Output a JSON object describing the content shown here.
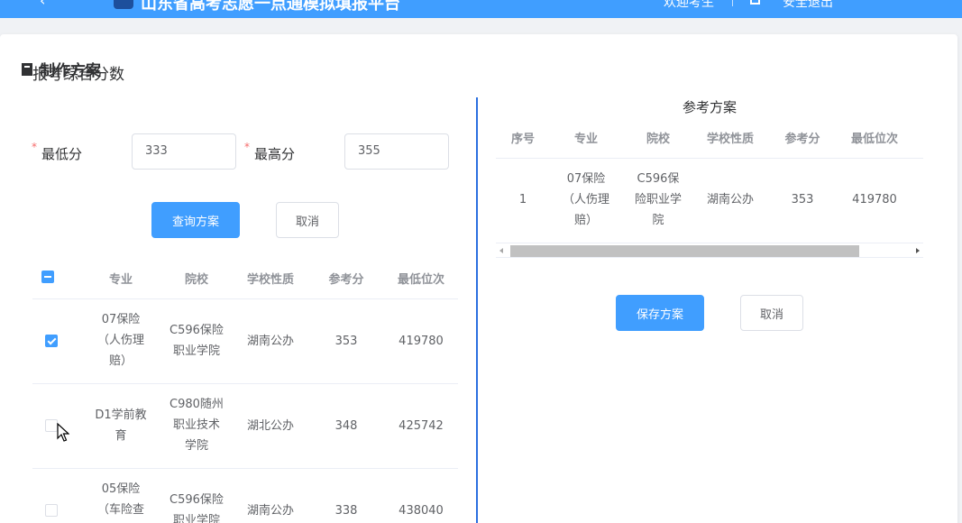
{
  "header": {
    "back_glyph": "‹",
    "title": "山东省高考志愿一点通模拟填报平台",
    "user": "欢迎考生",
    "logout": "安全退出"
  },
  "card": {
    "title": "制作方案"
  },
  "left": {
    "section_title": "报考综合分数",
    "min_label": "最低分",
    "min_value": "333",
    "max_label": "最高分",
    "max_value": "355",
    "required_mark": "*",
    "query_button": "查询方案",
    "cancel_button": "取消",
    "columns": [
      "专业",
      "院校",
      "学校性质",
      "参考分",
      "最低位次"
    ],
    "rows": [
      {
        "checked": true,
        "major": [
          "07保险",
          "（人伤理",
          "赔）"
        ],
        "school": [
          "C596保险",
          "职业学院"
        ],
        "type": "湖南公办",
        "score": "353",
        "rank": "419780"
      },
      {
        "checked": false,
        "major": [
          "D1学前教",
          "育"
        ],
        "school": [
          "C980随州",
          "职业技术",
          "学院"
        ],
        "type": "湖北公办",
        "score": "348",
        "rank": "425742"
      },
      {
        "checked": false,
        "major": [
          "05保险",
          "（车险查"
        ],
        "school": [
          "C596保险",
          "职业学院"
        ],
        "type": "湖南公办",
        "score": "338",
        "rank": "438040"
      }
    ]
  },
  "right": {
    "title": "参考方案",
    "columns": [
      "序号",
      "专业",
      "院校",
      "学校性质",
      "参考分",
      "最低位次"
    ],
    "rows": [
      {
        "index": "1",
        "major": [
          "07保险",
          "（人伤理",
          "赔）"
        ],
        "school": [
          "C596保",
          "险职业学",
          "院"
        ],
        "type": "湖南公办",
        "score": "353",
        "rank": "419780"
      }
    ],
    "save_button": "保存方案",
    "cancel_button": "取消"
  },
  "colors": {
    "primary": "#409eff",
    "divider": "#2b6fe0",
    "required": "#f56c6c"
  }
}
